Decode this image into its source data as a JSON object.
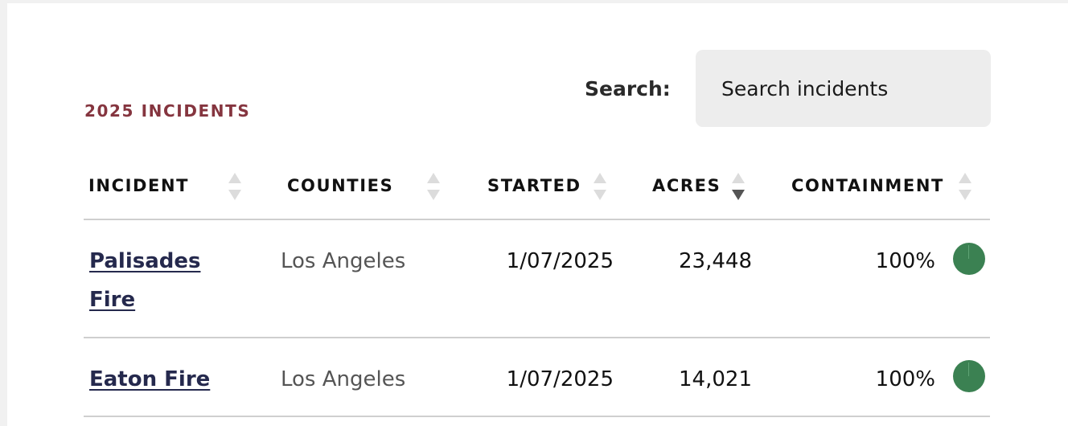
{
  "section": {
    "title": "2025 INCIDENTS"
  },
  "search": {
    "label": "Search:",
    "placeholder": "Search incidents",
    "value": ""
  },
  "table": {
    "columns": [
      {
        "label": "INCIDENT",
        "sort": "none"
      },
      {
        "label": "COUNTIES",
        "sort": "none"
      },
      {
        "label": "STARTED",
        "sort": "none"
      },
      {
        "label": "ACRES",
        "sort": "descending"
      },
      {
        "label": "CONTAINMENT",
        "sort": "none"
      }
    ],
    "rows": [
      {
        "incident": "Palisades Fire",
        "counties": "Los Angeles",
        "started": "1/07/2025",
        "acres": "23,448",
        "containment": "100%",
        "containment_value": 1.0
      },
      {
        "incident": "Eaton Fire",
        "counties": "Los Angeles",
        "started": "1/07/2025",
        "acres": "14,021",
        "containment": "100%",
        "containment_value": 1.0
      }
    ]
  },
  "colors": {
    "section_title": "#85353f",
    "link": "#25294d",
    "containment_full": "#3b8152",
    "sort_active": "#555555",
    "sort_inactive": "#dcdcdc"
  }
}
